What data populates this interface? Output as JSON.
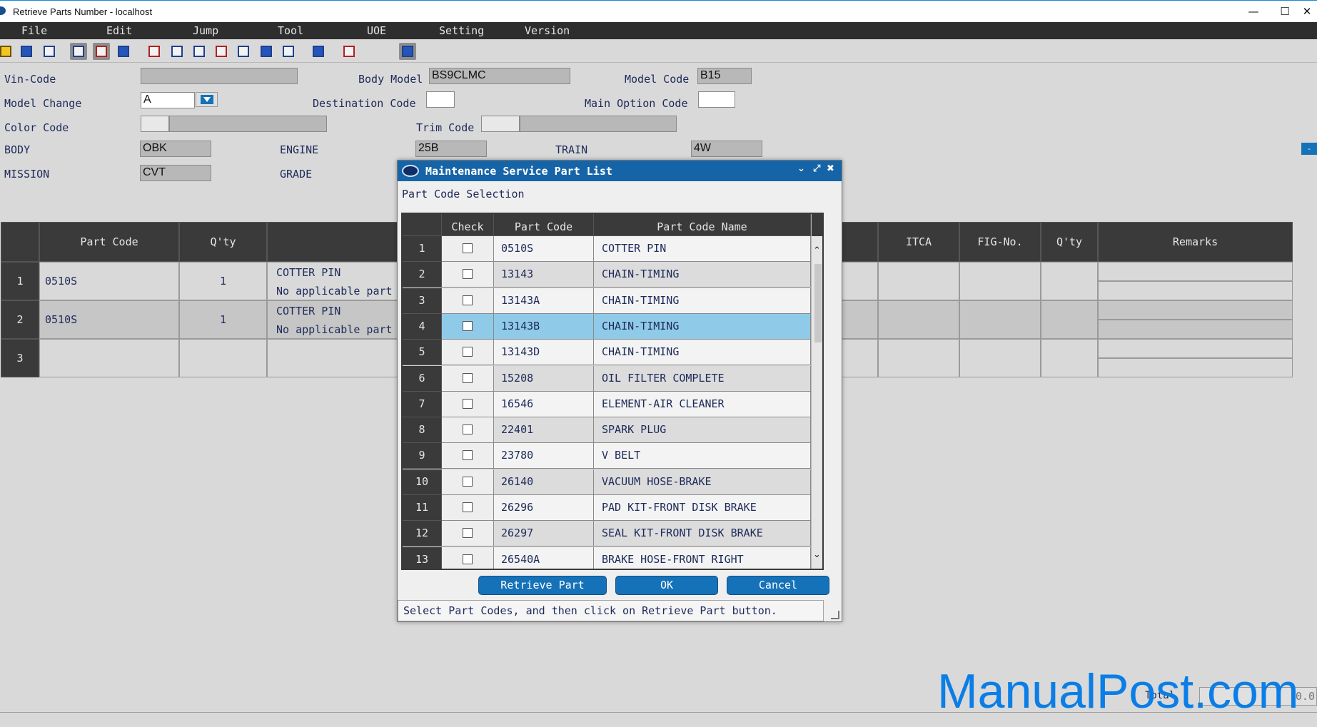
{
  "window": {
    "title": "Retrieve Parts Number - localhost",
    "minimize": "—",
    "maximize": "☐",
    "close": "✕"
  },
  "menu": [
    "File",
    "Edit",
    "Jump",
    "Tool",
    "UOE",
    "Setting",
    "Version"
  ],
  "form": {
    "vin_code_label": "Vin-Code",
    "vin_code": "",
    "body_model_label": "Body Model",
    "body_model": "BS9CLMC",
    "model_code_label": "Model Code",
    "model_code": "B15",
    "model_change_label": "Model Change",
    "model_change": "A",
    "destination_code_label": "Destination Code",
    "destination_code": "",
    "main_option_code_label": "Main Option Code",
    "main_option_code": "",
    "color_code_label": "Color Code",
    "color_code": "",
    "color_name": "",
    "trim_code_label": "Trim Code",
    "trim_code": "",
    "trim_name": "",
    "body_label": "BODY",
    "body": "OBK",
    "engine_label": "ENGINE",
    "engine": "25B",
    "train_label": "TRAIN",
    "train": "4W",
    "mission_label": "MISSION",
    "mission": "CVT",
    "grade_label": "GRADE"
  },
  "side_tab": "-",
  "main_table": {
    "headers": {
      "part_code": "Part Code",
      "qty": "Q'ty",
      "itca": "ITCA",
      "fig_no": "FIG-No.",
      "qty2": "Q'ty",
      "remarks": "Remarks"
    },
    "rows": [
      {
        "num": "1",
        "part_code": "0510S",
        "qty": "1",
        "name": "COTTER PIN",
        "note": "No applicable part"
      },
      {
        "num": "2",
        "part_code": "0510S",
        "qty": "1",
        "name": "COTTER PIN",
        "note": "No applicable part"
      },
      {
        "num": "3",
        "part_code": "",
        "qty": "",
        "name": "",
        "note": ""
      }
    ]
  },
  "dialog": {
    "title": "Maintenance Service Part List",
    "subtitle": "Part Code Selection",
    "headers": {
      "check": "Check",
      "part_code": "Part Code",
      "part_code_name": "Part Code Name"
    },
    "rows": [
      {
        "num": "1",
        "code": "0510S",
        "name": "COTTER PIN"
      },
      {
        "num": "2",
        "code": "13143",
        "name": "CHAIN-TIMING"
      },
      {
        "num": "3",
        "code": "13143A",
        "name": "CHAIN-TIMING"
      },
      {
        "num": "4",
        "code": "13143B",
        "name": "CHAIN-TIMING"
      },
      {
        "num": "5",
        "code": "13143D",
        "name": "CHAIN-TIMING"
      },
      {
        "num": "6",
        "code": "15208",
        "name": "OIL FILTER COMPLETE"
      },
      {
        "num": "7",
        "code": "16546",
        "name": "ELEMENT-AIR CLEANER"
      },
      {
        "num": "8",
        "code": "22401",
        "name": "SPARK PLUG"
      },
      {
        "num": "9",
        "code": "23780",
        "name": "V BELT"
      },
      {
        "num": "10",
        "code": "26140",
        "name": "VACUUM HOSE-BRAKE"
      },
      {
        "num": "11",
        "code": "26296",
        "name": "PAD KIT-FRONT DISK BRAKE"
      },
      {
        "num": "12",
        "code": "26297",
        "name": "SEAL KIT-FRONT DISK BRAKE"
      },
      {
        "num": "13",
        "code": "26540A",
        "name": "BRAKE HOSE-FRONT RIGHT"
      }
    ],
    "selected_row": "4",
    "buttons": {
      "retrieve": "Retrieve Part",
      "ok": "OK",
      "cancel": "Cancel"
    },
    "status": "Select Part Codes, and then click on Retrieve Part button."
  },
  "footer": {
    "total_label": "Total",
    "total_value": "0.0"
  },
  "watermark": "ManualPost.com",
  "colors": {
    "accent": "#1672b8",
    "header": "#3a3a3a",
    "selected": "#8fcbe8",
    "watermark": "#0a7ee6"
  }
}
